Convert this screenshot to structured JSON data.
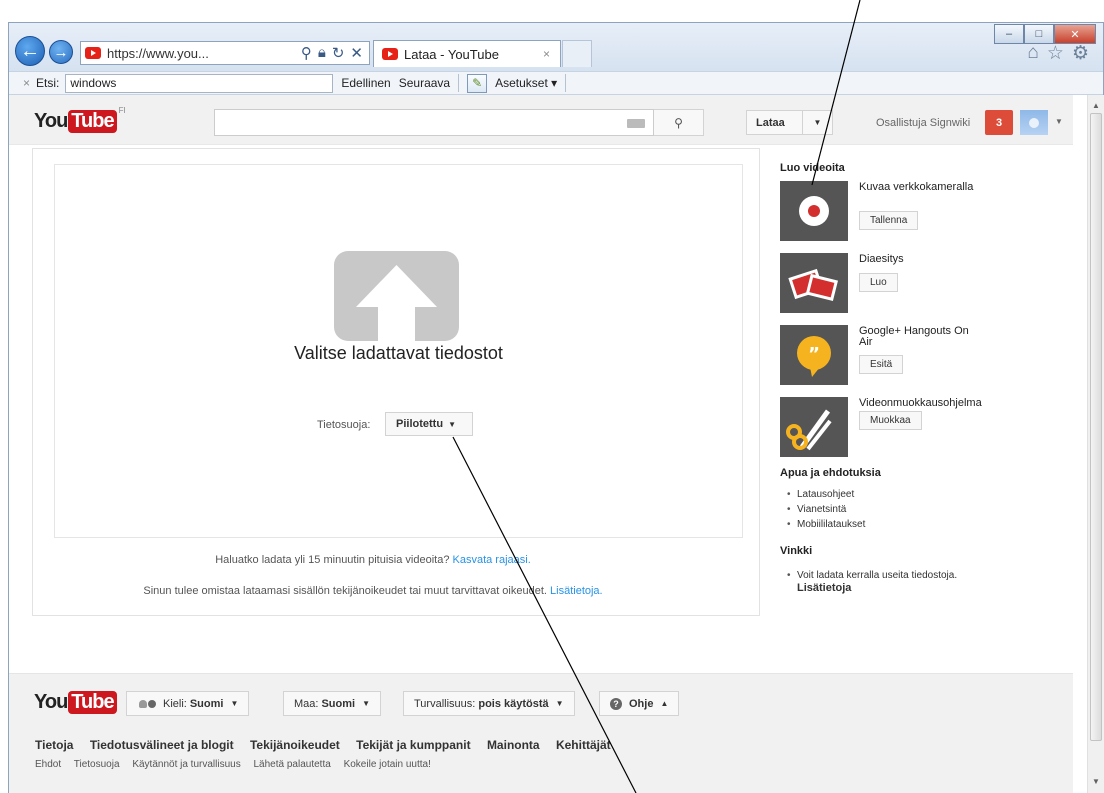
{
  "browser": {
    "address": "https://www.you...",
    "tab_title": "Lataa - YouTube",
    "tab_close": "×",
    "window_buttons": {
      "minimize": "–",
      "maximize": "□",
      "close": "✕"
    },
    "toolbar_icons": [
      "home-icon",
      "star-icon",
      "gear-icon"
    ],
    "find": {
      "close": "×",
      "label": "Etsi:",
      "value": "windows",
      "previous": "Edellinen",
      "next": "Seuraava",
      "settings": "Asetukset"
    }
  },
  "youtube": {
    "logo_you": "You",
    "logo_tube": "Tube",
    "logo_region": "FI",
    "upload_button": "Lataa",
    "user_name": "Osallistuja Signwiki",
    "notifications": "3"
  },
  "upload": {
    "select_files": "Valitse ladattavat tiedostot",
    "privacy_label": "Tietosuoja:",
    "privacy_value": "Piilotettu",
    "long_video_text": "Haluatko ladata yli 15 minuutin pituisia videoita?",
    "long_video_link": "Kasvata rajaasi.",
    "rights_text": "Sinun tulee omistaa lataamasi sisällön tekijänoikeudet tai muut tarvittavat oikeudet.",
    "rights_link": "Lisätietoja."
  },
  "sidebar": {
    "create_heading": "Luo videoita",
    "create_items": [
      {
        "title": "Kuvaa verkkokameralla",
        "button": "Tallenna",
        "icon": "record-icon"
      },
      {
        "title": "Diaesitys",
        "button": "Luo",
        "icon": "photos-icon"
      },
      {
        "title": "Google+ Hangouts On Air",
        "button": "Esitä",
        "icon": "hangouts-icon"
      },
      {
        "title": "Videonmuokkausohjelma",
        "button": "Muokkaa",
        "icon": "scissors-icon"
      }
    ],
    "help_heading": "Apua ja ehdotuksia",
    "help_links": [
      "Latausohjeet",
      "Vianetsintä",
      "Mobiililataukset"
    ],
    "tips_heading": "Vinkki",
    "tip_text": "Voit ladata kerralla useita tiedostoja.",
    "tip_link": "Lisätietoja"
  },
  "footer": {
    "language_label": "Kieli:",
    "language_value": "Suomi",
    "country_label": "Maa:",
    "country_value": "Suomi",
    "safety_label": "Turvallisuus:",
    "safety_value": "pois käytöstä",
    "help": "Ohje",
    "main_links": [
      "Tietoja",
      "Tiedotusvälineet ja blogit",
      "Tekijänoikeudet",
      "Tekijät ja kumppanit",
      "Mainonta",
      "Kehittäjät"
    ],
    "sub_links": [
      "Ehdot",
      "Tietosuoja",
      "Käytännöt ja turvallisuus",
      "Lähetä palautetta",
      "Kokeile jotain uutta!"
    ]
  }
}
